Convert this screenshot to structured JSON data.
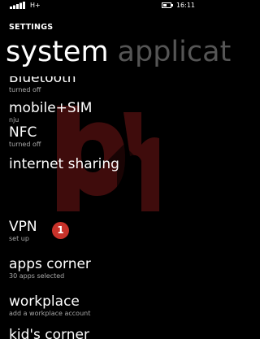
{
  "status_bar": {
    "network_type": "H+",
    "time": "16:11",
    "signal_icon": "signal-bars-icon",
    "battery_icon": "battery-icon",
    "battery_level": 0.55
  },
  "header": {
    "app_title": "SETTINGS"
  },
  "pivot": {
    "tabs": [
      {
        "label": "system",
        "selected": true
      },
      {
        "label": "applicat",
        "selected": false
      }
    ]
  },
  "settings_list": {
    "items": [
      {
        "title": "Bluetooth",
        "subtitle": "turned off"
      },
      {
        "title": "mobile+SIM",
        "subtitle": "nju"
      },
      {
        "title": "NFC",
        "subtitle": "turned off"
      },
      {
        "title": "internet sharing",
        "subtitle": ""
      },
      {
        "title": "VPN",
        "subtitle": "set up"
      },
      {
        "title": "apps corner",
        "subtitle": "30 apps selected"
      },
      {
        "title": "workplace",
        "subtitle": "add a workplace account"
      },
      {
        "title": "kid's corner",
        "subtitle": ""
      }
    ]
  },
  "annotation": {
    "badge_number": "1",
    "badge_color": "#c8322a"
  },
  "colors": {
    "background": "#000000",
    "text_primary": "#ffffff",
    "text_secondary": "#a8a8a8",
    "pivot_inactive": "#555555",
    "watermark": "#4a0f0f"
  }
}
